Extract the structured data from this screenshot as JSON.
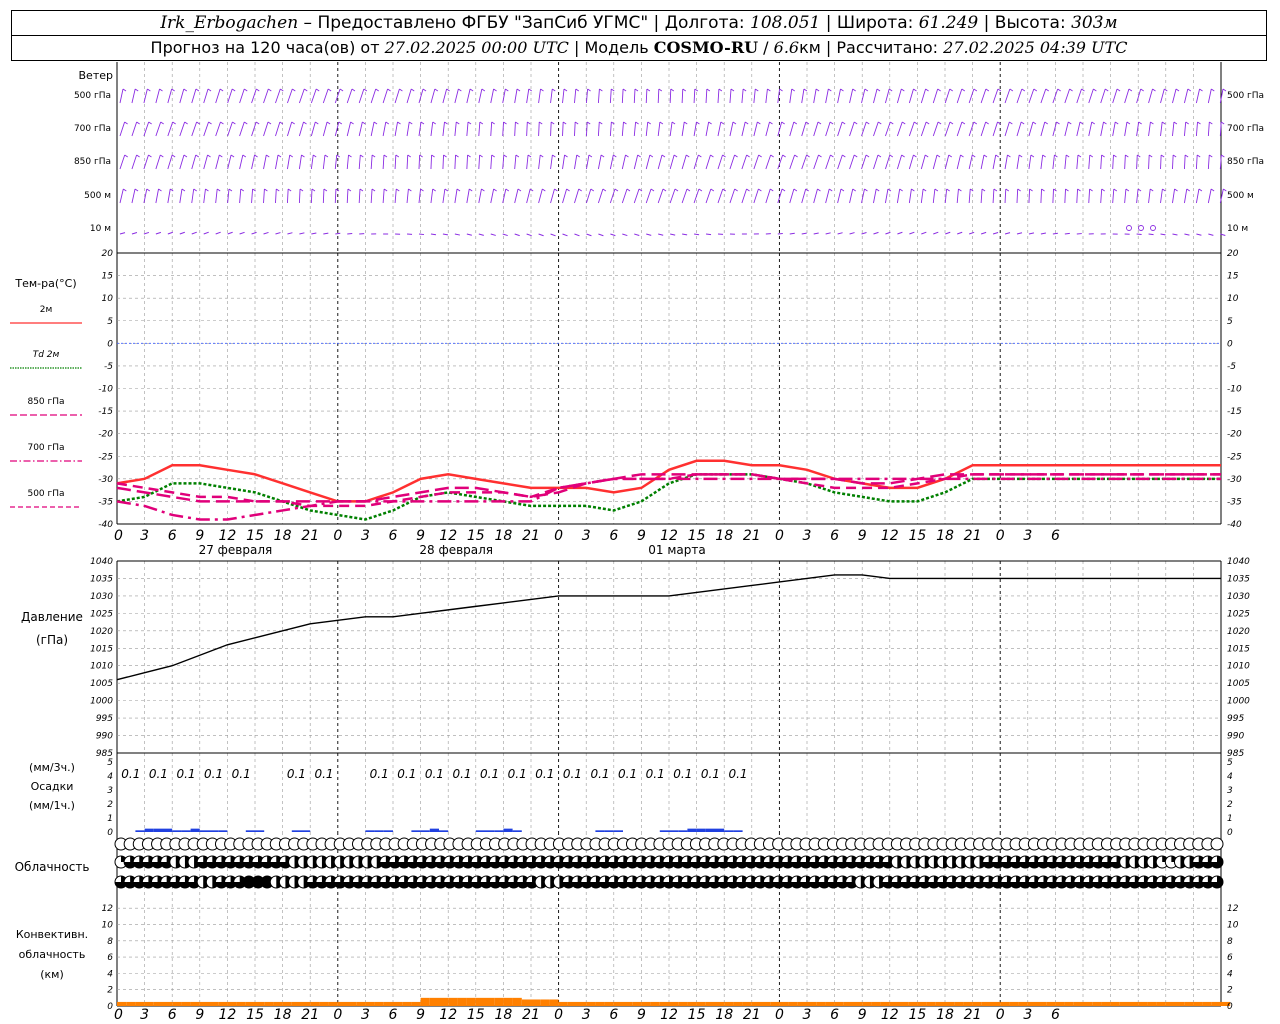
{
  "header": {
    "station": "Irk_Erbogachen",
    "dash": "–",
    "provider": "Предоставлено ФГБУ \"ЗапСиб УГМС\"",
    "lon_label": "Долгота:",
    "lon": "108.051",
    "lat_label": "Широта:",
    "lat": "61.249",
    "alt_label": "Высота:",
    "alt": "303м",
    "forecast_prefix": "Прогноз на 120 часа(ов) от",
    "forecast_time": "27.02.2025 00:00 UTC",
    "model_label": "Модель",
    "model": "COSMO-RU",
    "resolution": "6.6",
    "resolution_unit": "км",
    "calc_label": "Рассчитано:",
    "calc_time": "27.02.2025 04:39 UTC"
  },
  "labels": {
    "wind": "Ветер",
    "wind_levels": [
      "500 гПа",
      "700 гПа",
      "850 гПа",
      "500 м",
      "10 м"
    ],
    "temp_title": "Тем-ра(°C)",
    "temp_legend": [
      "2м",
      "Td 2м",
      "850 гПа",
      "700 гПа",
      "500 гПа"
    ],
    "pressure": [
      "Давление",
      "(гПа)"
    ],
    "precip": [
      "(мм/3ч.)",
      "Осадки",
      "(мм/1ч.)"
    ],
    "cloud": "Облачность",
    "conv": [
      "Конвективн.",
      "облачность",
      "(км)"
    ],
    "days": [
      "27 февраля",
      "28 февраля",
      "01 марта"
    ]
  },
  "colors": {
    "t2m": "#ff3030",
    "td2m": "#008000",
    "t850": "#e0007a",
    "t700": "#e0007a",
    "t500": "#e0007a",
    "zero_line": "#4060ff",
    "wind": "#8a2be2",
    "pressure": "#000000",
    "precip": "#2040e0",
    "conv": "#ff8000",
    "grid": "#9a9a9a"
  },
  "chart_data": [
    {
      "type": "line",
      "title": "Тем-ра(°C)",
      "x_hours": [
        0,
        3,
        6,
        9,
        12,
        15,
        18,
        21,
        24,
        27,
        30,
        33,
        36,
        39,
        42,
        45,
        48,
        51,
        54,
        57,
        60,
        63,
        66,
        69,
        72,
        75,
        78,
        81,
        84,
        87,
        90,
        93,
        96,
        99,
        102,
        105,
        108,
        111,
        114,
        117,
        120
      ],
      "x_tick_labels": [
        "0",
        "3",
        "6",
        "9",
        "12",
        "15",
        "18",
        "21",
        "0",
        "3",
        "6",
        "9",
        "12",
        "15",
        "18",
        "21",
        "0",
        "3",
        "6",
        "9",
        "12",
        "15",
        "18",
        "21",
        "0",
        "3",
        "6",
        "9",
        "12",
        "15",
        "18",
        "21",
        "0",
        "3",
        "6"
      ],
      "ylim": [
        -40,
        20
      ],
      "yticks": [
        20,
        15,
        10,
        5,
        0,
        -5,
        -10,
        -15,
        -20,
        -25,
        -30,
        -35,
        -40
      ],
      "series": [
        {
          "name": "2м",
          "values": [
            -31,
            -30,
            -27,
            -27,
            -28,
            -29,
            -31,
            -33,
            -35,
            -35,
            -33,
            -30,
            -29,
            -30,
            -31,
            -32,
            -32,
            -32,
            -33,
            -32,
            -28,
            -26,
            -26,
            -27,
            -27,
            -28,
            -30,
            -31,
            -32,
            -32,
            -30,
            -27,
            -27,
            -27,
            -27,
            -27,
            -27,
            -27,
            -27,
            -27,
            -27
          ]
        },
        {
          "name": "Td 2м",
          "values": [
            -35,
            -34,
            -31,
            -31,
            -32,
            -33,
            -35,
            -37,
            -38,
            -39,
            -37,
            -34,
            -33,
            -34,
            -35,
            -36,
            -36,
            -36,
            -37,
            -35,
            -31,
            -29,
            -29,
            -29,
            -30,
            -31,
            -33,
            -34,
            -35,
            -35,
            -33,
            -30,
            -30,
            -30,
            -30,
            -30,
            -30,
            -30,
            -30,
            -30,
            -30
          ]
        },
        {
          "name": "850 гПа",
          "values": [
            -32,
            -33,
            -34,
            -35,
            -35,
            -35,
            -35,
            -35,
            -35,
            -35,
            -34,
            -33,
            -32,
            -32,
            -33,
            -34,
            -33,
            -31,
            -30,
            -29,
            -29,
            -29,
            -29,
            -29,
            -30,
            -30,
            -30,
            -31,
            -31,
            -30,
            -29,
            -29,
            -29,
            -29,
            -29,
            -29,
            -29,
            -29,
            -29,
            -29,
            -29
          ]
        },
        {
          "name": "700 гПа",
          "values": [
            -35,
            -36,
            -38,
            -39,
            -39,
            -38,
            -37,
            -36,
            -35,
            -35,
            -35,
            -35,
            -35,
            -35,
            -35,
            -35,
            -32,
            -31,
            -30,
            -30,
            -30,
            -30,
            -30,
            -30,
            -30,
            -30,
            -30,
            -30,
            -30,
            -30,
            -30,
            -30,
            -30,
            -30,
            -30,
            -30,
            -30,
            -30,
            -30,
            -30,
            -30
          ]
        },
        {
          "name": "500 гПа",
          "values": [
            -31,
            -32,
            -33,
            -34,
            -34,
            -35,
            -35,
            -36,
            -36,
            -36,
            -35,
            -34,
            -33,
            -33,
            -33,
            -34,
            -32,
            -31,
            -30,
            -30,
            -30,
            -29,
            -29,
            -29,
            -30,
            -31,
            -32,
            -32,
            -32,
            -31,
            -30,
            -29,
            -29,
            -29,
            -29,
            -29,
            -29,
            -29,
            -29,
            -29,
            -29
          ]
        }
      ]
    },
    {
      "type": "line",
      "title": "Давление (гПа)",
      "x_hours": [
        0,
        3,
        6,
        9,
        12,
        15,
        18,
        21,
        24,
        27,
        30,
        33,
        36,
        39,
        42,
        45,
        48,
        51,
        54,
        57,
        60,
        63,
        66,
        69,
        72,
        75,
        78,
        81,
        84,
        87,
        90,
        93,
        96,
        99,
        102,
        105,
        108,
        111,
        114,
        117,
        120
      ],
      "ylim": [
        985,
        1040
      ],
      "yticks": [
        1040,
        1035,
        1030,
        1025,
        1020,
        1015,
        1010,
        1005,
        1000,
        995,
        990,
        985
      ],
      "series": [
        {
          "name": "Давление",
          "values": [
            1006,
            1008,
            1010,
            1013,
            1016,
            1018,
            1020,
            1022,
            1023,
            1024,
            1024,
            1025,
            1026,
            1027,
            1028,
            1029,
            1030,
            1030,
            1030,
            1030,
            1030,
            1031,
            1032,
            1033,
            1034,
            1035,
            1036,
            1036,
            1035,
            1035,
            1035,
            1035,
            1035,
            1035,
            1035,
            1035,
            1035,
            1035,
            1035,
            1035,
            1035
          ]
        }
      ]
    },
    {
      "type": "bar",
      "title": "Осадки",
      "ylim": [
        0,
        5
      ],
      "yticks": [
        5,
        4,
        3,
        2,
        1,
        0
      ],
      "precip_labels": [
        "0.1",
        "0.1",
        "0.1",
        "0.1",
        "0.1",
        "",
        "0.1",
        "0.1",
        "",
        "0.1",
        "0.1",
        "0.1",
        "0.1",
        "0.1",
        "0.1",
        "0.1",
        "0.1",
        "0.1",
        "0.1",
        "0.1",
        "0.1",
        "0.1",
        "0.1"
      ],
      "precip_label_hours": [
        1.5,
        4.5,
        7.5,
        10.5,
        13.5,
        16.5,
        19.5,
        22.5,
        25.5,
        28.5,
        31.5,
        34.5,
        37.5,
        40.5,
        43.5,
        46.5,
        49.5,
        52.5,
        55.5,
        58.5,
        61.5,
        64.5,
        67.5
      ],
      "hourly_mm": [
        0,
        0,
        0.1,
        0.2,
        0.2,
        0.2,
        0.1,
        0.1,
        0.2,
        0.1,
        0.1,
        0.1,
        0,
        0,
        0.1,
        0.1,
        0,
        0,
        0,
        0.1,
        0.1,
        0,
        0,
        0,
        0,
        0,
        0,
        0.1,
        0.1,
        0.1,
        0,
        0,
        0.1,
        0.1,
        0.2,
        0.1,
        0,
        0,
        0,
        0.1,
        0.1,
        0.1,
        0.2,
        0.1,
        0,
        0,
        0,
        0,
        0,
        0,
        0,
        0,
        0.1,
        0.1,
        0.1,
        0,
        0,
        0,
        0,
        0.1,
        0.1,
        0.1,
        0.2,
        0.2,
        0.2,
        0.2,
        0.1,
        0.1,
        0,
        0,
        0,
        0,
        0,
        0,
        0,
        0,
        0,
        0,
        0,
        0,
        0,
        0,
        0,
        0,
        0,
        0,
        0,
        0,
        0,
        0,
        0,
        0,
        0,
        0,
        0,
        0,
        0,
        0,
        0,
        0,
        0,
        0,
        0,
        0,
        0,
        0,
        0,
        0,
        0,
        0,
        0,
        0,
        0,
        0,
        0,
        0,
        0,
        0,
        0,
        0,
        0
      ]
    },
    {
      "type": "table",
      "title": "Облачность",
      "rows": [
        "high",
        "mid",
        "low"
      ],
      "cover_fraction": {
        "high": [
          0,
          0,
          0,
          0,
          0,
          0,
          0,
          0,
          0,
          0,
          0,
          0,
          0,
          0,
          0,
          0,
          0,
          0,
          0,
          0,
          0,
          0,
          0,
          0,
          0,
          0,
          0,
          0,
          0,
          0,
          0,
          0,
          0,
          0,
          0,
          0,
          0,
          0,
          0,
          0,
          0,
          0,
          0,
          0,
          0,
          0,
          0,
          0,
          0,
          0,
          0,
          0,
          0,
          0,
          0,
          0,
          0,
          0,
          0,
          0,
          0,
          0,
          0,
          0,
          0,
          0,
          0,
          0,
          0,
          0,
          0,
          0,
          0,
          0,
          0,
          0,
          0,
          0,
          0,
          0,
          0,
          0,
          0,
          0,
          0,
          0,
          0,
          0,
          0,
          0,
          0,
          0,
          0,
          0,
          0,
          0,
          0,
          0,
          0,
          0,
          0,
          0,
          0,
          0,
          0,
          0,
          0,
          0,
          0,
          0,
          0,
          0,
          0,
          0,
          0,
          0,
          0,
          0,
          0,
          0,
          0
        ],
        "mid": [
          0.25,
          0.75,
          0.75,
          0.75,
          0.75,
          0.75,
          0.5,
          0.5,
          0.5,
          0.75,
          0.75,
          0.75,
          0.75,
          0.75,
          0.75,
          0.75,
          0.75,
          0.75,
          0.75,
          0.5,
          0.5,
          0.5,
          0.5,
          0.5,
          0.5,
          0.5,
          0.5,
          0.5,
          0.5,
          0.75,
          0.75,
          0.75,
          0.75,
          0.75,
          0.75,
          0.75,
          0.75,
          0.75,
          0.75,
          0.75,
          0.75,
          0.75,
          0.75,
          0.75,
          0.75,
          0.75,
          0.75,
          0.75,
          0.75,
          0.75,
          0.75,
          0.75,
          0.75,
          0.75,
          0.75,
          0.75,
          0.75,
          0.75,
          0.75,
          0.75,
          0.75,
          0.75,
          0.75,
          0.75,
          0.75,
          0.75,
          0.75,
          0.75,
          0.75,
          0.75,
          0.75,
          0.75,
          0.75,
          0.75,
          0.75,
          0.75,
          0.75,
          0.75,
          0.75,
          0.75,
          0.75,
          0.75,
          0.75,
          0.75,
          0.75,
          0.5,
          0.5,
          0.5,
          0.5,
          0.5,
          0.5,
          0.5,
          0.5,
          0.5,
          0.5,
          0.75,
          0.75,
          0.75,
          0.75,
          0.75,
          0.75,
          0.75,
          0.75,
          0.75,
          0.75,
          0.75,
          0.75,
          0.75,
          0.75,
          0.75,
          0.5,
          0.5,
          0.5,
          0.5,
          0.25,
          0.25,
          0.5,
          0.5,
          0.75,
          0.75,
          0.75
        ],
        "low": [
          0.75,
          0.75,
          0.75,
          0.75,
          0.75,
          0.75,
          0.75,
          0.75,
          0.75,
          0.5,
          0.5,
          0.75,
          0.75,
          0.75,
          1,
          1,
          1,
          0.5,
          0.5,
          0.5,
          0.5,
          0.75,
          0.75,
          0.75,
          0.75,
          0.75,
          0.75,
          0.75,
          0.75,
          0.75,
          0.75,
          0.75,
          0.75,
          0.75,
          0.75,
          0.75,
          0.75,
          0.75,
          0.75,
          0.75,
          0.75,
          0.75,
          0.75,
          0.75,
          0.75,
          0.75,
          0.5,
          0.5,
          0.5,
          0.75,
          0.75,
          0.75,
          0.75,
          0.75,
          0.75,
          0.75,
          0.75,
          0.75,
          0.75,
          0.75,
          0.75,
          0.75,
          0.75,
          0.75,
          0.75,
          0.75,
          0.75,
          0.75,
          0.75,
          0.75,
          0.75,
          0.75,
          0.75,
          0.75,
          0.75,
          0.75,
          0.75,
          0.75,
          0.75,
          0.75,
          0.75,
          0.5,
          0.5,
          0.5,
          0.75,
          0.75,
          0.75,
          0.75,
          0.75,
          0.75,
          0.75,
          0.75,
          0.75,
          0.75,
          0.75,
          0.75,
          0.75,
          0.75,
          0.75,
          0.75,
          0.75,
          0.75,
          0.75,
          0.75,
          0.75,
          0.75,
          0.75,
          0.75,
          0.75,
          0.75,
          0.75,
          0.75,
          0.75,
          0.75,
          0.75,
          0.75,
          0.75,
          0.75,
          0.75,
          0.75,
          0.75
        ]
      }
    },
    {
      "type": "bar",
      "title": "Конвективн. облачность (км)",
      "ylim": [
        0,
        13
      ],
      "yticks": [
        12,
        10,
        8,
        6,
        4,
        2,
        0
      ],
      "hourly_km": [
        0.5,
        0.5,
        0.5,
        0.5,
        0.5,
        0.5,
        0.5,
        0.5,
        0.5,
        0.5,
        0.5,
        0.5,
        0.5,
        0.5,
        0.5,
        0.5,
        0.5,
        0.5,
        0.5,
        0.5,
        0.5,
        0.5,
        0.5,
        0.5,
        0.5,
        0.5,
        0.5,
        0.5,
        0.5,
        0.5,
        0.5,
        0.5,
        0.5,
        1.0,
        1.0,
        1.0,
        1.0,
        1.0,
        1.0,
        1.0,
        1.0,
        1.0,
        1.0,
        1.0,
        0.8,
        0.8,
        0.8,
        0.8,
        0.5,
        0.5,
        0.5,
        0.5,
        0.5,
        0.5,
        0.5,
        0.5,
        0.5,
        0.5,
        0.5,
        0.5,
        0.5,
        0.5,
        0.5,
        0.5,
        0.5,
        0.5,
        0.5,
        0.5,
        0.5,
        0.5,
        0.5,
        0.5,
        0.5,
        0.5,
        0.5,
        0.5,
        0.5,
        0.5,
        0.5,
        0.5,
        0.5,
        0.5,
        0.5,
        0.5,
        0.5,
        0.5,
        0.5,
        0.5,
        0.5,
        0.5,
        0.5,
        0.5,
        0.5,
        0.5,
        0.5,
        0.5,
        0.5,
        0.5,
        0.5,
        0.5,
        0.5,
        0.5,
        0.5,
        0.5,
        0.5,
        0.5,
        0.5,
        0.5,
        0.5,
        0.5,
        0.5,
        0.5,
        0.5,
        0.5,
        0.5,
        0.5,
        0.5,
        0.5,
        0.5,
        0.5,
        0.5
      ]
    }
  ]
}
